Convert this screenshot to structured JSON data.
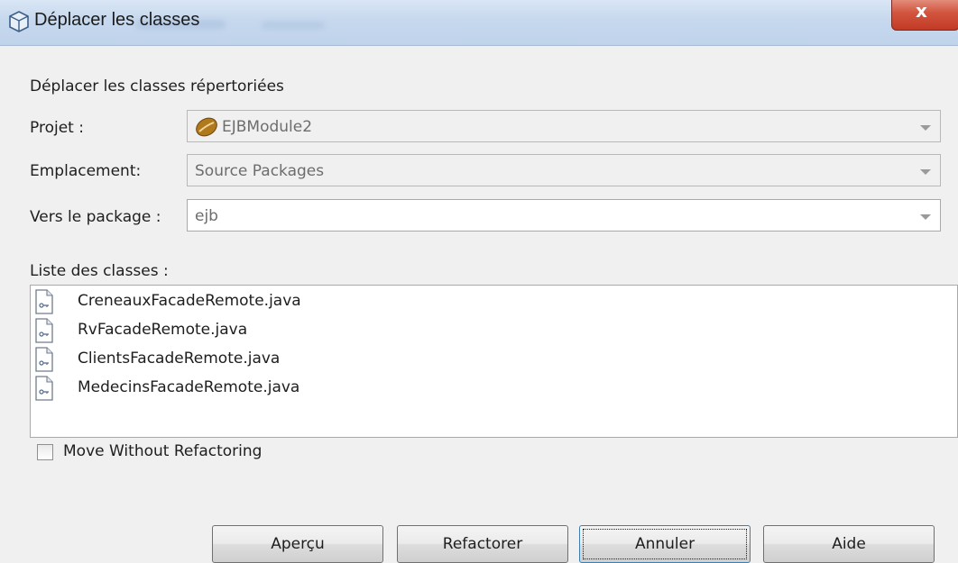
{
  "window": {
    "title": "Déplacer les classes",
    "close_label": "x"
  },
  "form": {
    "heading": "Déplacer les classes répertoriées",
    "project_label": "Projet :",
    "project_value": "EJBModule2",
    "location_label": "Emplacement:",
    "location_value": "Source Packages",
    "package_label": "Vers le package :",
    "package_value": "ejb",
    "class_list_label": "Liste des classes :"
  },
  "class_list": [
    {
      "name": "CreneauxFacadeRemote.java"
    },
    {
      "name": "RvFacadeRemote.java"
    },
    {
      "name": "ClientsFacadeRemote.java"
    },
    {
      "name": "MedecinsFacadeRemote.java"
    }
  ],
  "options": {
    "move_without_refactoring_label": "Move Without Refactoring",
    "move_without_refactoring_checked": false
  },
  "buttons": {
    "preview": "Aperçu",
    "refactor": "Refactorer",
    "cancel": "Annuler",
    "help": "Aide"
  }
}
